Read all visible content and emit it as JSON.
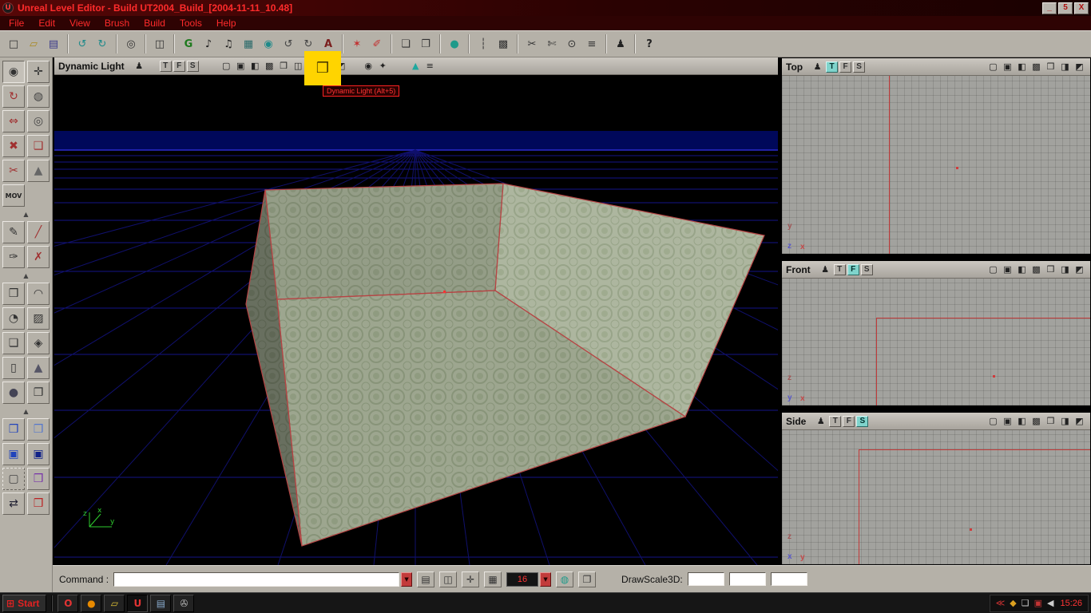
{
  "window": {
    "app_initial": "U",
    "title": "Unreal Level Editor - Build UT2004_Build_[2004-11-11_10.48]",
    "minimize": "_",
    "restore": "5",
    "close": "X"
  },
  "menu": {
    "items": [
      {
        "name": "menu-file",
        "label": "File"
      },
      {
        "name": "menu-edit",
        "label": "Edit"
      },
      {
        "name": "menu-view",
        "label": "View"
      },
      {
        "name": "menu-brush",
        "label": "Brush"
      },
      {
        "name": "menu-build",
        "label": "Build"
      },
      {
        "name": "menu-tools",
        "label": "Tools"
      },
      {
        "name": "menu-help",
        "label": "Help"
      }
    ]
  },
  "toolbar": {
    "buttons": [
      {
        "name": "new-map-button",
        "glyph": "□",
        "color": "#333"
      },
      {
        "name": "open-map-button",
        "glyph": "▱",
        "color": "#a8891f"
      },
      {
        "name": "save-map-button",
        "glyph": "▤",
        "color": "#3a3a8a"
      },
      {
        "type": "sep"
      },
      {
        "name": "undo-button",
        "glyph": "↺",
        "color": "#1f8a8a"
      },
      {
        "name": "redo-button",
        "glyph": "↻",
        "color": "#1f8a8a"
      },
      {
        "type": "sep"
      },
      {
        "name": "search-actors-button",
        "glyph": "◎",
        "color": "#333"
      },
      {
        "type": "sep"
      },
      {
        "name": "fullscreen-button",
        "glyph": "◫",
        "color": "#333"
      },
      {
        "type": "sep"
      },
      {
        "name": "group-browser-button",
        "glyph": "G",
        "color": "#1e7a1e",
        "cls": "bold"
      },
      {
        "name": "music-browser-button",
        "glyph": "♪",
        "color": "#222"
      },
      {
        "name": "sound-browser-button",
        "glyph": "♫",
        "color": "#222"
      },
      {
        "name": "texture-browser-button",
        "glyph": "▦",
        "color": "#2a6a6a"
      },
      {
        "name": "mesh-browser-button",
        "glyph": "◉",
        "color": "#1f8a8a"
      },
      {
        "name": "build-geometry-button",
        "glyph": "↺",
        "color": "#444"
      },
      {
        "name": "build-changed-button",
        "glyph": "↻",
        "color": "#444"
      },
      {
        "name": "actor-class-browser-button",
        "glyph": "A",
        "color": "#7a1e1e",
        "cls": "bold"
      },
      {
        "type": "sep"
      },
      {
        "name": "add-light-button",
        "glyph": "✶",
        "color": "#c23232"
      },
      {
        "name": "add-marker-button",
        "glyph": "✐",
        "color": "#c23232"
      },
      {
        "type": "sep"
      },
      {
        "name": "surface-properties-button",
        "glyph": "❏",
        "color": "#333"
      },
      {
        "name": "level-properties-button",
        "glyph": "❐",
        "color": "#333"
      },
      {
        "type": "sep"
      },
      {
        "name": "play-level-button",
        "glyph": "●",
        "color": "#1f9a8a"
      },
      {
        "type": "sep"
      },
      {
        "name": "align-strip-button",
        "glyph": "┆",
        "color": "#333"
      },
      {
        "name": "texture-lock-button",
        "glyph": "▩",
        "color": "#333"
      },
      {
        "type": "sep"
      },
      {
        "name": "brush-clip-toolbar-button",
        "glyph": "✂",
        "color": "#333"
      },
      {
        "name": "split-poly-button",
        "glyph": "✄",
        "color": "#333"
      },
      {
        "name": "freeform-button",
        "glyph": "⊙",
        "color": "#333"
      },
      {
        "name": "sliders-button",
        "glyph": "≡",
        "color": "#333"
      },
      {
        "type": "sep"
      },
      {
        "name": "joystick-button",
        "glyph": "♟",
        "color": "#222"
      },
      {
        "type": "sep"
      },
      {
        "name": "context-help-button",
        "glyph": "?",
        "color": "#222",
        "cls": "bold"
      }
    ]
  },
  "palette": {
    "buttons": [
      {
        "name": "camera-mode-button",
        "glyph": "◉",
        "color": "#333",
        "cls": "active"
      },
      {
        "name": "move-mode-button",
        "glyph": "✛",
        "color": "#333"
      },
      {
        "name": "rotate-mode-button",
        "glyph": "↻",
        "color": "#a03030"
      },
      {
        "name": "scale-mode-button",
        "glyph": "◍",
        "color": "#444"
      },
      {
        "name": "stretch-mode-button",
        "glyph": "⇔",
        "color": "#a03030"
      },
      {
        "name": "texture-pan-button",
        "glyph": "◎",
        "color": "#444"
      },
      {
        "name": "texture-rotate-button",
        "glyph": "✖",
        "color": "#a03030"
      },
      {
        "name": "vertex-edit-button",
        "glyph": "❑",
        "color": "#a03030"
      },
      {
        "name": "brush-clip-mode-button",
        "glyph": "✂",
        "color": "#a03030"
      },
      {
        "name": "terrain-mode-button",
        "glyph": "▲",
        "color": "#666"
      },
      {
        "name": "matinee-button",
        "glyph": "MOV",
        "color": "#222",
        "cls": "mov"
      },
      {
        "name": "palette-blank",
        "glyph": "",
        "cls": "blank"
      },
      {
        "type": "arrow"
      },
      {
        "name": "pen-tool-button",
        "glyph": "✎",
        "color": "#333"
      },
      {
        "name": "line-tool-button",
        "glyph": "╱",
        "color": "#a03030"
      },
      {
        "name": "pick-tool-button",
        "glyph": "✑",
        "color": "#333"
      },
      {
        "name": "cut-tool-button",
        "glyph": "✗",
        "color": "#a03030"
      },
      {
        "type": "arrow"
      },
      {
        "name": "cube-builder-button",
        "glyph": "❒",
        "color": "#333"
      },
      {
        "name": "curved-stairs-builder-button",
        "glyph": "◠",
        "color": "#333"
      },
      {
        "name": "spiral-stairs-builder-button",
        "glyph": "◔",
        "color": "#333"
      },
      {
        "name": "linear-stairs-builder-button",
        "glyph": "▨",
        "color": "#333"
      },
      {
        "name": "sheet-builder-button",
        "glyph": "❏",
        "color": "#333"
      },
      {
        "name": "tessellated-builder-button",
        "glyph": "◈",
        "color": "#333"
      },
      {
        "name": "cylinder-builder-button",
        "glyph": "▯",
        "color": "#333"
      },
      {
        "name": "cone-builder-button",
        "glyph": "▲",
        "color": "#556"
      },
      {
        "name": "sphere-builder-button",
        "glyph": "●",
        "color": "#445"
      },
      {
        "name": "volumetric-builder-button",
        "glyph": "❐",
        "color": "#333"
      },
      {
        "type": "arrow"
      },
      {
        "name": "csg-add-button",
        "glyph": "❒",
        "color": "#2244bb"
      },
      {
        "name": "csg-subtract-button",
        "glyph": "❒",
        "color": "#5577cc"
      },
      {
        "name": "csg-intersect-button",
        "glyph": "▣",
        "color": "#2244bb"
      },
      {
        "name": "csg-deintersect-button",
        "glyph": "▣",
        "color": "#112288"
      },
      {
        "name": "select-marquee-button",
        "glyph": "▢",
        "color": "#444",
        "cls": "dotted"
      },
      {
        "name": "add-mover-button",
        "glyph": "❒",
        "color": "#7733aa"
      },
      {
        "name": "swap-selection-button",
        "glyph": "⇄",
        "color": "#223"
      },
      {
        "name": "add-antiportal-button",
        "glyph": "❒",
        "color": "#bb2222"
      }
    ]
  },
  "glyphs": {
    "actor": "♟",
    "eye": "◉",
    "plug": "✦",
    "terrain": "▲",
    "menu": "≡"
  },
  "persp": {
    "title": "Dynamic Light",
    "tooltip": "Dynamic Light (Alt+5)",
    "highlight_glyph": "❒",
    "tfs": [
      {
        "name": "persp-toggle-t",
        "label": "T"
      },
      {
        "name": "persp-toggle-f",
        "label": "F"
      },
      {
        "name": "persp-toggle-s",
        "label": "S"
      }
    ],
    "modes": [
      {
        "name": "wireframe-mode-button",
        "glyph": "▢"
      },
      {
        "name": "overhead-mode-button",
        "glyph": "▣"
      },
      {
        "name": "bsp-cuts-mode-button",
        "glyph": "◧"
      },
      {
        "name": "textured-mode-button",
        "glyph": "▩"
      },
      {
        "name": "lit-mode-button",
        "glyph": "❒"
      },
      {
        "name": "light-only-mode-button",
        "glyph": "◫"
      },
      {
        "name": "dynamic-light-mode-button",
        "glyph": "❒"
      },
      {
        "name": "zone-portal-mode-button",
        "glyph": "◨"
      },
      {
        "name": "depth-complexity-mode-button",
        "glyph": "◩"
      }
    ],
    "axis": {
      "z": "z",
      "x": "x",
      "y": "y"
    }
  },
  "ortho_modes": [
    {
      "name": "wireframe-mode-button",
      "glyph": "▢"
    },
    {
      "name": "overhead-mode-button",
      "glyph": "▣"
    },
    {
      "name": "bsp-cuts-mode-button",
      "glyph": "◧"
    },
    {
      "name": "textured-mode-button",
      "glyph": "▩"
    },
    {
      "name": "lit-mode-button",
      "glyph": "❒"
    },
    {
      "name": "zone-portal-mode-button",
      "glyph": "◨"
    },
    {
      "name": "depth-complexity-mode-button",
      "glyph": "◩"
    }
  ],
  "viewports": {
    "top": {
      "title": "Top",
      "tfs": [
        {
          "name": "top-toggle-t",
          "label": "T",
          "cls": "active"
        },
        {
          "name": "top-toggle-f",
          "label": "F"
        },
        {
          "name": "top-toggle-s",
          "label": "S"
        }
      ],
      "axes": {
        "v": "y",
        "o": "z",
        "h": "x"
      }
    },
    "front": {
      "title": "Front",
      "tfs": [
        {
          "name": "front-toggle-t",
          "label": "T"
        },
        {
          "name": "front-toggle-f",
          "label": "F",
          "cls": "active"
        },
        {
          "name": "front-toggle-s",
          "label": "S"
        }
      ],
      "axes": {
        "v": "z",
        "o": "y",
        "h": "x"
      }
    },
    "side": {
      "title": "Side",
      "tfs": [
        {
          "name": "side-toggle-t",
          "label": "T"
        },
        {
          "name": "side-toggle-f",
          "label": "F"
        },
        {
          "name": "side-toggle-s",
          "label": "S",
          "cls": "active"
        }
      ],
      "axes": {
        "v": "z",
        "o": "x",
        "h": "y"
      }
    }
  },
  "command_bar": {
    "label": "Command :",
    "input_value": "",
    "dropdown_glyph": "▼",
    "console_glyph": "▤",
    "anchor_glyph": "◫",
    "move_glyph": "✛",
    "grid_glyph": "▦",
    "grid_size": "16",
    "realtime_glyph": "◍",
    "panel_glyph": "❐",
    "drawscale_label": "DrawScale3D:",
    "ds_values": [
      "",
      "",
      ""
    ]
  },
  "taskbar": {
    "logo_glyph": "⊞",
    "start_label": "Start",
    "quick_launch": [
      {
        "name": "opera-launcher",
        "glyph": "O",
        "color": "#e33333"
      },
      {
        "name": "orange-app-launcher",
        "glyph": "●",
        "color": "#e88a00"
      },
      {
        "name": "folder-launcher",
        "glyph": "▱",
        "color": "#ddc035"
      },
      {
        "name": "unrealed-taskbar-button",
        "glyph": "U",
        "color": "#e33333",
        "cls": "pressed"
      },
      {
        "name": "notepad-launcher",
        "glyph": "▤",
        "color": "#88aacc"
      },
      {
        "name": "keys-launcher",
        "glyph": "✇",
        "color": "#bbbbbb"
      }
    ],
    "tray": [
      {
        "name": "hidden-icons-arrow",
        "glyph": "≪",
        "color": "#d33333"
      },
      {
        "name": "ut2004-tray-icon",
        "glyph": "◆",
        "color": "#dca020"
      },
      {
        "name": "document-tray-icon",
        "glyph": "❏",
        "color": "#cccccc"
      },
      {
        "name": "red-grid-tray-icon",
        "glyph": "▣",
        "color": "#c23333"
      },
      {
        "name": "volume-tray-icon",
        "glyph": "◀",
        "color": "#cccccc"
      }
    ],
    "clock": "15:26"
  }
}
